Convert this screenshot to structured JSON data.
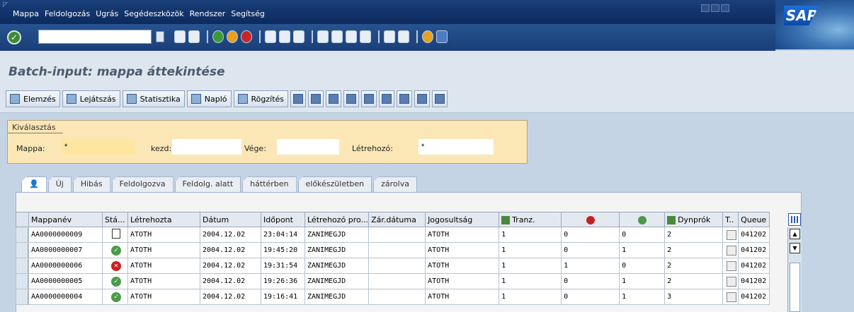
{
  "menu": {
    "items": [
      {
        "label": "Mappa"
      },
      {
        "label": "Feldolgozás"
      },
      {
        "label": "Ugrás"
      },
      {
        "label": "Segédeszközök"
      },
      {
        "label": "Rendszer"
      },
      {
        "label": "Segítség"
      }
    ],
    "logo": "SAP"
  },
  "command_field": {
    "value": ""
  },
  "title": "Batch-input: mappa áttekintése",
  "app_toolbar": {
    "buttons": [
      {
        "label": "Elemzés",
        "icon": "analysis-icon"
      },
      {
        "label": "Lejátszás",
        "icon": "play-icon"
      },
      {
        "label": "Statisztika",
        "icon": "statistics-icon"
      },
      {
        "label": "Napló",
        "icon": "log-icon"
      },
      {
        "label": "Rögzítés",
        "icon": "record-icon"
      }
    ]
  },
  "selection": {
    "caption": "Kiválasztás",
    "mappa_label": "Mappa:",
    "mappa_value": "*",
    "kezd_label": "kezd:",
    "kezd_value": "",
    "vege_label": "Vége:",
    "vege_value": "",
    "letrehozo_label": "Létrehozó:",
    "letrehozo_value": "*"
  },
  "tabs": [
    {
      "label": ""
    },
    {
      "label": "Új"
    },
    {
      "label": "Hibás"
    },
    {
      "label": "Feldolgozva"
    },
    {
      "label": "Feldolg. alatt"
    },
    {
      "label": "háttérben"
    },
    {
      "label": "előkészületben"
    },
    {
      "label": "zárolva"
    }
  ],
  "table": {
    "headers": {
      "mappanev": "Mappanév",
      "statusz": "Stá...",
      "letrehozta": "Létrehozta",
      "datum": "Dátum",
      "idopont": "Időpont",
      "letrehozo_pro": "Létrehozó pro...",
      "zar_datuma": "Zár.dátuma",
      "jogosultsag": "Jogosultság",
      "tranz": "Tranz.",
      "dynprok": "Dynprók",
      "t": "T..",
      "queue": "Queue"
    },
    "rows": [
      {
        "mappanev": "AA0000000009",
        "status": "new",
        "letrehozta": "ATOTH",
        "datum": "2004.12.02",
        "idopont": "23:04:14",
        "pro": "ZANIMEGJD",
        "zar": "",
        "jog": "ATOTH",
        "tranz": "1",
        "err": "0",
        "ok": "0",
        "dyn": "2",
        "queue": "041202"
      },
      {
        "mappanev": "AA0000000007",
        "status": "processed",
        "letrehozta": "ATOTH",
        "datum": "2004.12.02",
        "idopont": "19:45:20",
        "pro": "ZANIMEGJD",
        "zar": "",
        "jog": "ATOTH",
        "tranz": "1",
        "err": "0",
        "ok": "1",
        "dyn": "2",
        "queue": "041202"
      },
      {
        "mappanev": "AA0000000006",
        "status": "error",
        "letrehozta": "ATOTH",
        "datum": "2004.12.02",
        "idopont": "19:31:54",
        "pro": "ZANIMEGJD",
        "zar": "",
        "jog": "ATOTH",
        "tranz": "1",
        "err": "1",
        "ok": "0",
        "dyn": "2",
        "queue": "041202"
      },
      {
        "mappanev": "AA0000000005",
        "status": "processed",
        "letrehozta": "ATOTH",
        "datum": "2004.12.02",
        "idopont": "19:26:36",
        "pro": "ZANIMEGJD",
        "zar": "",
        "jog": "ATOTH",
        "tranz": "1",
        "err": "0",
        "ok": "1",
        "dyn": "2",
        "queue": "041202"
      },
      {
        "mappanev": "AA0000000004",
        "status": "processed",
        "letrehozta": "ATOTH",
        "datum": "2004.12.02",
        "idopont": "19:16:41",
        "pro": "ZANIMEGJD",
        "zar": "",
        "jog": "ATOTH",
        "tranz": "1",
        "err": "0",
        "ok": "1",
        "dyn": "3",
        "queue": "041202"
      }
    ]
  }
}
